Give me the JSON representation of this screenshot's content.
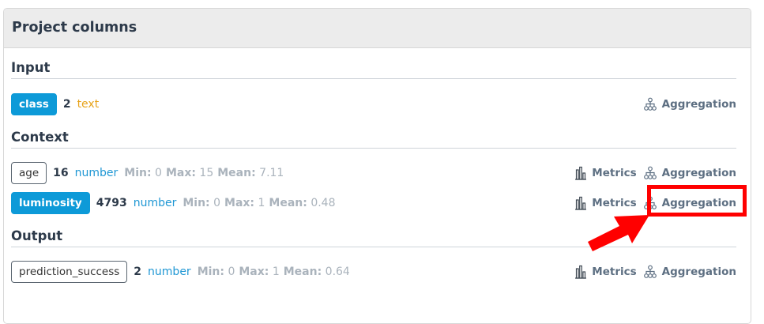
{
  "panel": {
    "title": "Project columns"
  },
  "sections": {
    "input": {
      "title": "Input",
      "rows": [
        {
          "name": "class",
          "count": "2",
          "type": "text",
          "aggregation_label": "Aggregation"
        }
      ]
    },
    "context": {
      "title": "Context",
      "rows": [
        {
          "name": "age",
          "count": "16",
          "type": "number",
          "min_label": "Min:",
          "min": "0",
          "max_label": "Max:",
          "max": "15",
          "mean_label": "Mean:",
          "mean": "7.11",
          "metrics_label": "Metrics",
          "aggregation_label": "Aggregation"
        },
        {
          "name": "luminosity",
          "count": "4793",
          "type": "number",
          "min_label": "Min:",
          "min": "0",
          "max_label": "Max:",
          "max": "1",
          "mean_label": "Mean:",
          "mean": "0.48",
          "metrics_label": "Metrics",
          "aggregation_label": "Aggregation"
        }
      ]
    },
    "output": {
      "title": "Output",
      "rows": [
        {
          "name": "prediction_success",
          "count": "2",
          "type": "number",
          "min_label": "Min:",
          "min": "0",
          "max_label": "Max:",
          "max": "1",
          "mean_label": "Mean:",
          "mean": "0.64",
          "metrics_label": "Metrics",
          "aggregation_label": "Aggregation"
        }
      ]
    }
  },
  "colors": {
    "primary_chip": "#0d9ad8",
    "type_text": "#e7a31a",
    "type_number": "#1f97d4",
    "annotation": "#ff0000"
  },
  "icons": {
    "metrics": "bar-chart-icon",
    "aggregation": "hierarchy-tree-icon"
  }
}
